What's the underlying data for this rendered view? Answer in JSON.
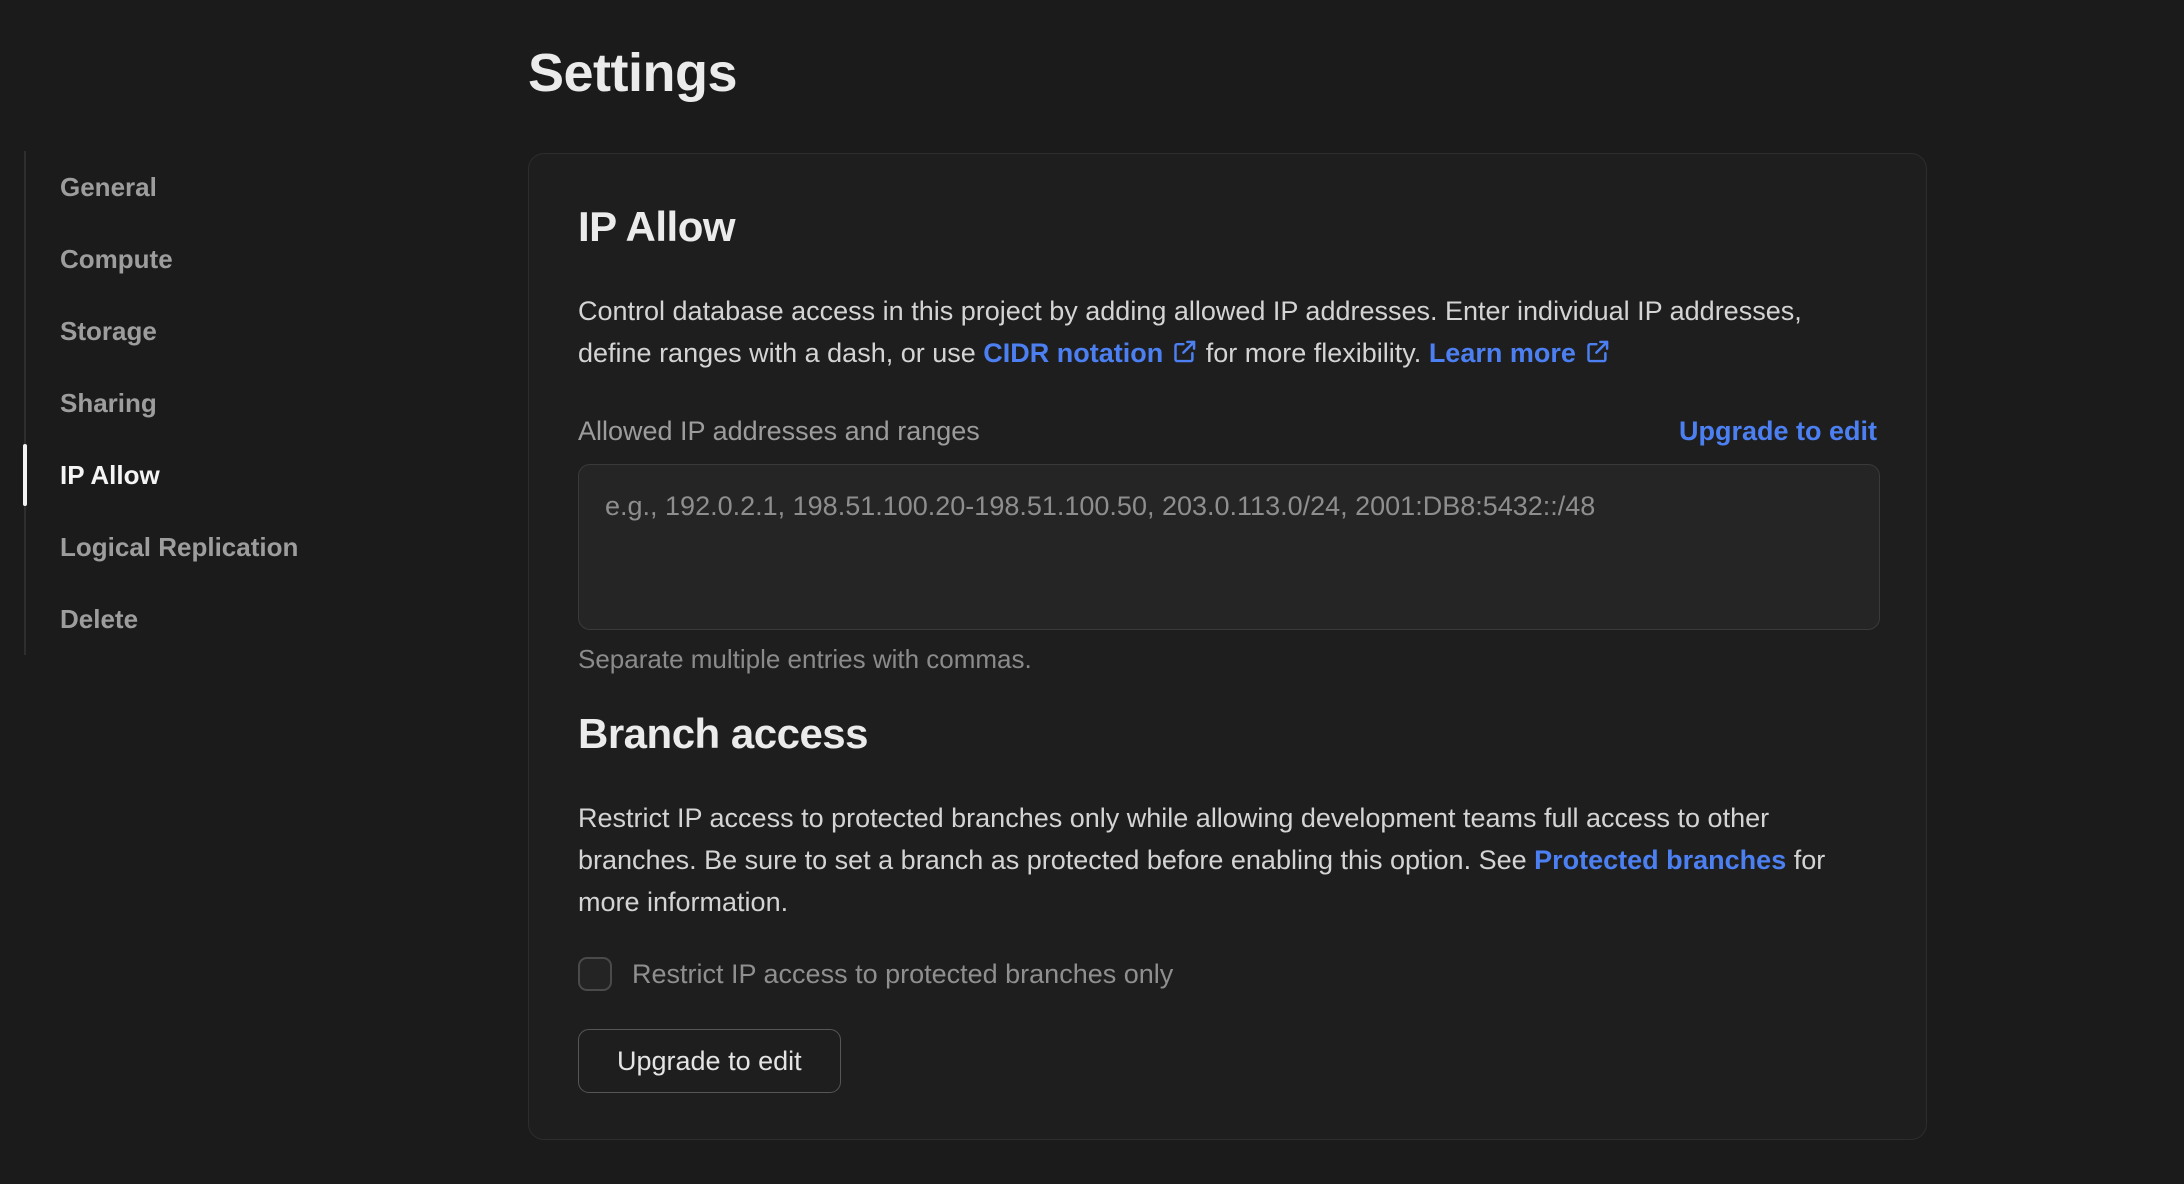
{
  "page": {
    "title": "Settings"
  },
  "sidebar": {
    "items": [
      {
        "label": "General",
        "active": false
      },
      {
        "label": "Compute",
        "active": false
      },
      {
        "label": "Storage",
        "active": false
      },
      {
        "label": "Sharing",
        "active": false
      },
      {
        "label": "IP Allow",
        "active": true
      },
      {
        "label": "Logical Replication",
        "active": false
      },
      {
        "label": "Delete",
        "active": false
      }
    ]
  },
  "ip_allow": {
    "heading": "IP Allow",
    "desc_part1": "Control database access in this project by adding allowed IP addresses. Enter individual IP addresses, define ranges with a dash, or use ",
    "cidr_link_label": "CIDR notation",
    "desc_part2": " for more flexibility. ",
    "learn_more_label": "Learn more",
    "field_label": "Allowed IP addresses and ranges",
    "upgrade_link_label": "Upgrade to edit",
    "textarea_value": "",
    "textarea_placeholder": "e.g., 192.0.2.1, 198.51.100.20-198.51.100.50, 203.0.113.0/24, 2001:DB8:5432::/48",
    "helper_text": "Separate multiple entries with commas."
  },
  "branch_access": {
    "heading": "Branch access",
    "desc_part1": "Restrict IP access to protected branches only while allowing development teams full access to other branches. Be sure to set a branch as protected before enabling this option. See ",
    "protected_link_label": "Protected branches",
    "desc_part2": " for more information.",
    "checkbox_label": "Restrict IP access to protected branches only",
    "checkbox_checked": false,
    "button_label": "Upgrade to edit"
  },
  "colors": {
    "accent_blue": "#4c80f2",
    "page_background": "#1b1b1b",
    "panel_background": "#1e1e1e",
    "active_nav_indicator": "#f2f2f2"
  },
  "icons": {
    "external_link": "external-link-icon"
  }
}
